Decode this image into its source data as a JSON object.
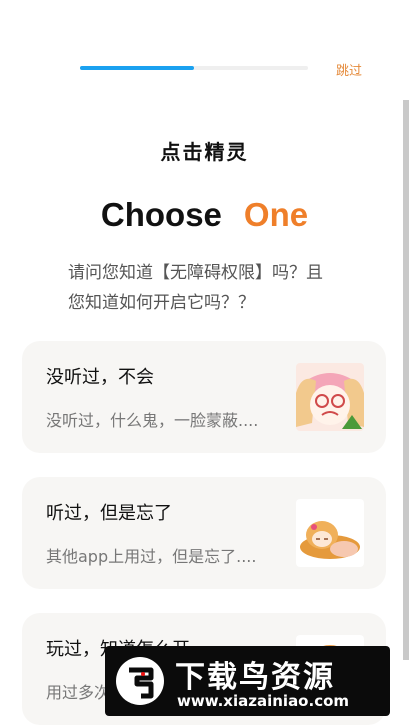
{
  "header": {
    "progress_fraction": 0.5,
    "skip_label": "跳过"
  },
  "app": {
    "name": "点击精灵"
  },
  "headline": {
    "word1": "Choose",
    "word2": "One"
  },
  "question": {
    "line1": "请问您知道【无障碍权限】吗？且",
    "line2": "您知道如何开启它吗？？"
  },
  "options": [
    {
      "title": "没听过，不会",
      "desc": "没听过，什么鬼，一脸蒙蔽...."
    },
    {
      "title": "听过，但是忘了",
      "desc": "其他app上用过，但是忘了...."
    },
    {
      "title": "玩过，知道怎么开",
      "desc": "用过多次"
    }
  ],
  "watermark": {
    "title": "下载鸟资源",
    "url": "www.xiazainiao.com"
  },
  "colors": {
    "accent_orange": "#ef7f2a",
    "progress_blue": "#1aa1f0",
    "card_bg": "#f7f6f4"
  }
}
